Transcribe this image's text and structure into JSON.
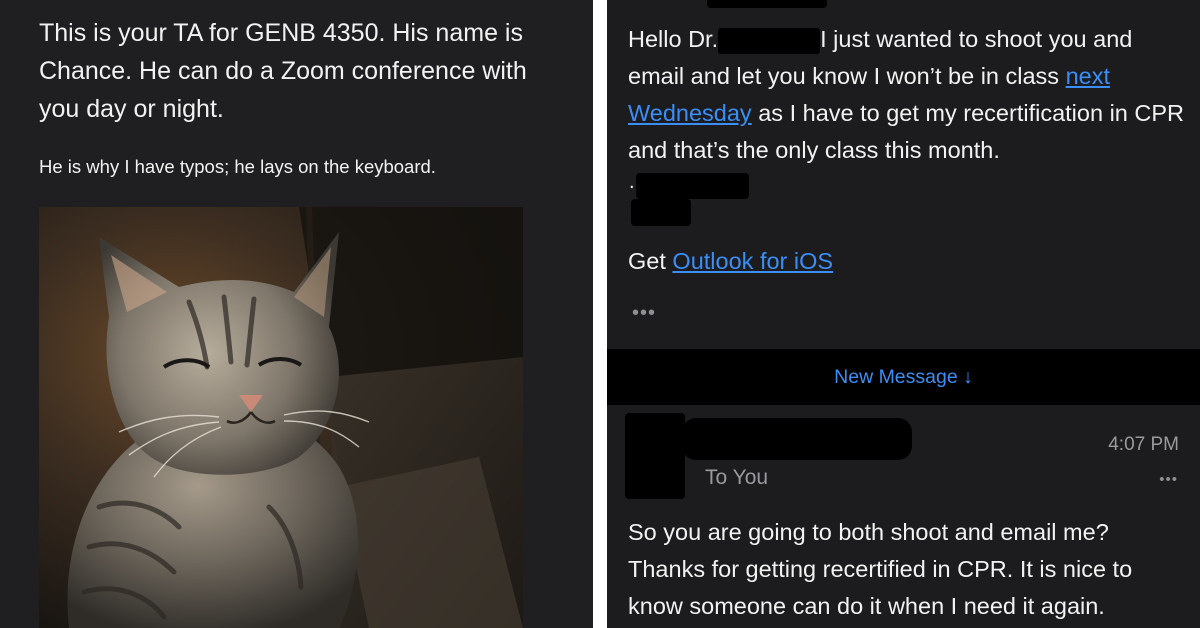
{
  "left_panel": {
    "intro_text": "This is your TA for GENB 4350. His name is Chance. He can do a Zoom conference with you day or night.",
    "typos_note": "He is why I have typos; he lays on the keyboard.",
    "photo_icon": "tabby-cat-photo"
  },
  "right_panel": {
    "email": {
      "greeting": "Hello Dr.",
      "body_part1": "I just wanted to shoot you and email and let you know I won’t be in class ",
      "link_next_wednesday": "next Wednesday",
      "body_part2": " as I have to get my recertification in CPR and that’s the only class this month.",
      "signature_dot": ".",
      "get_prefix": "Get ",
      "outlook_link": "Outlook for iOS",
      "more_icon": "ellipsis-icon"
    },
    "new_message_bar": {
      "label": "New Message ↓",
      "icon": "arrow-down-icon"
    },
    "reply": {
      "time": "4:07 PM",
      "to": "To You",
      "more_icon": "ellipsis-icon",
      "body": "So you are going to both shoot and email me? Thanks for getting recertified in CPR. It is nice to know someone can do it when I need it again."
    }
  },
  "colors": {
    "left_background": "#1f1f21",
    "right_background": "#1c1c1e",
    "link_blue": "#3a8ef5",
    "text": "#f2f2f2",
    "muted": "#9a9a9e"
  }
}
